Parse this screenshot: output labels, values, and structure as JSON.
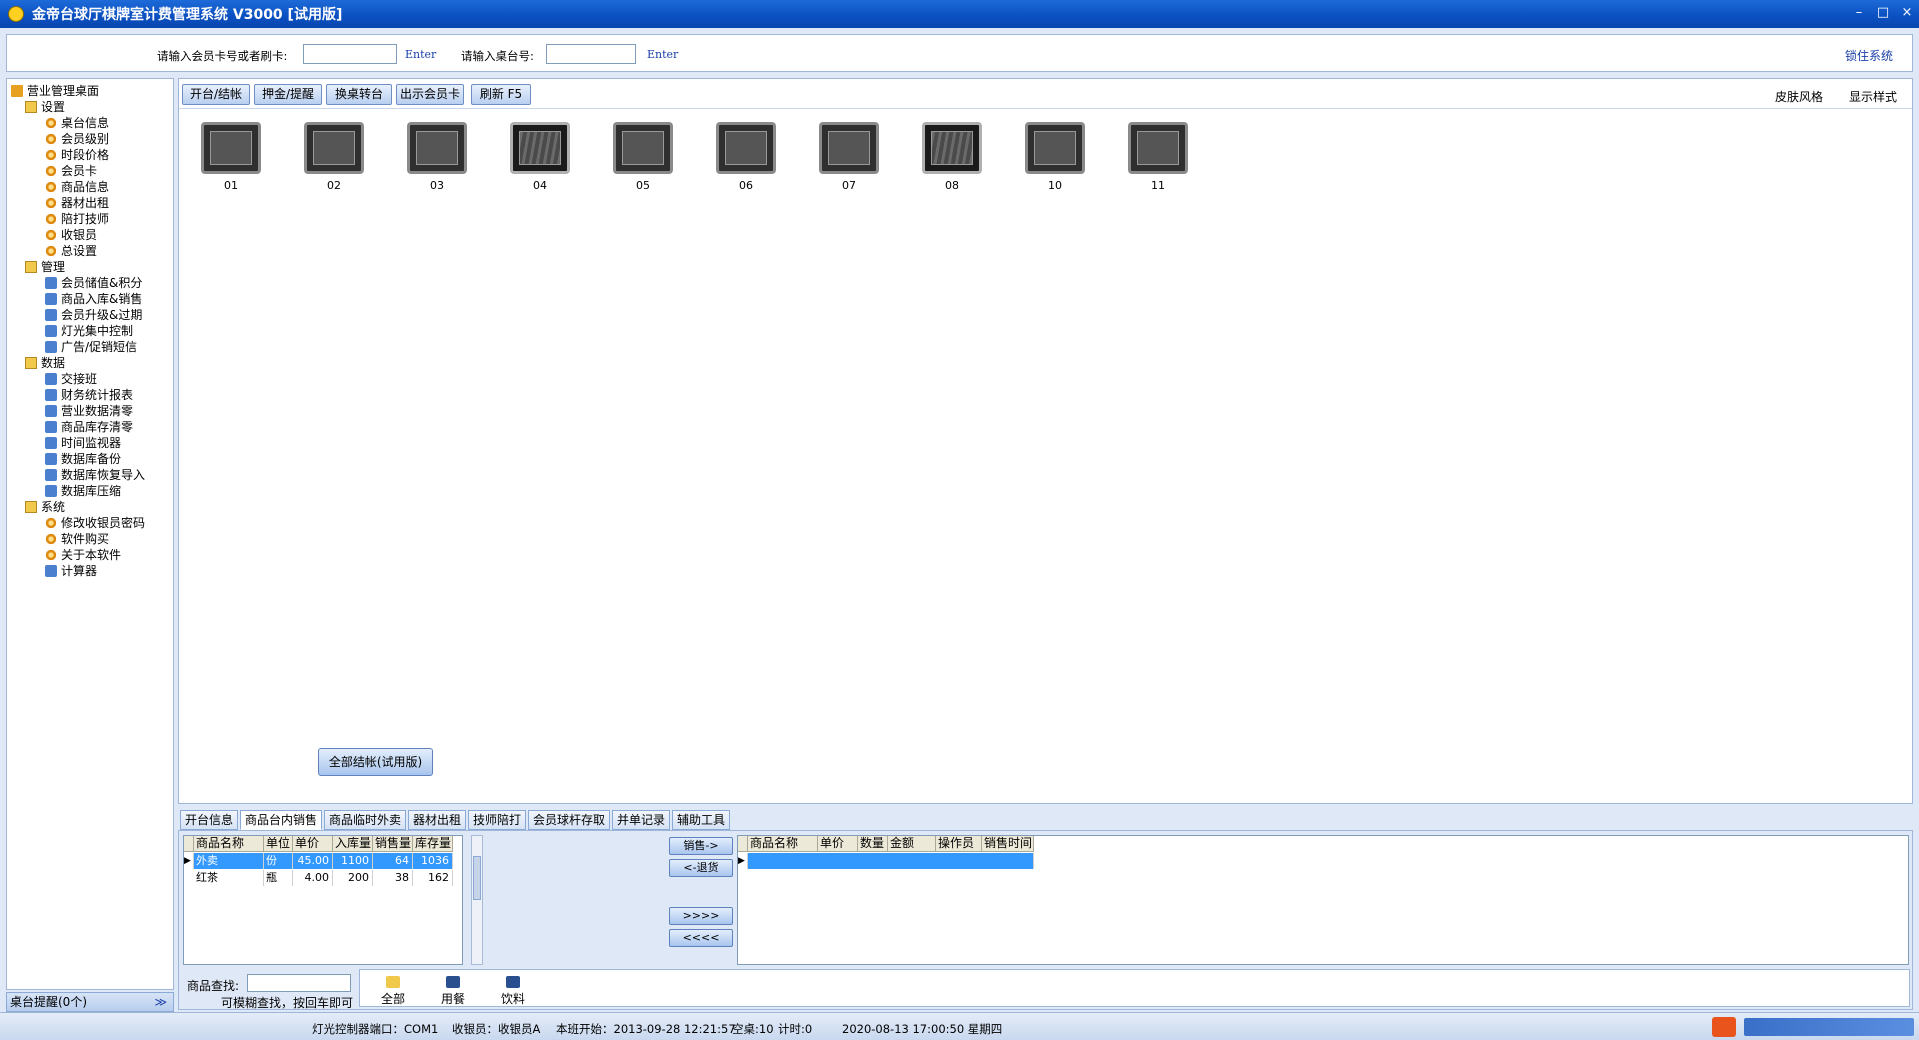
{
  "window": {
    "title": "金帝台球厅棋牌室计费管理系统 V3000 [试用版]",
    "min": "–",
    "max": "□",
    "close": "×"
  },
  "topbar": {
    "member_label": "请输入会员卡号或者刷卡:",
    "member_enter": "Enter",
    "table_label": "请输入桌台号:",
    "table_enter": "Enter",
    "lock": "锁住系统"
  },
  "tree": {
    "root": "营业管理桌面",
    "groups": [
      {
        "label": "设置",
        "items": [
          "桌台信息",
          "会员级别",
          "时段价格",
          "会员卡",
          "商品信息",
          "器材出租",
          "陪打技师",
          "收银员",
          "总设置"
        ]
      },
      {
        "label": "管理",
        "items": [
          "会员储值&积分",
          "商品入库&销售",
          "会员升级&过期",
          "灯光集中控制",
          "广告/促销短信"
        ]
      },
      {
        "label": "数据",
        "items": [
          "交接班",
          "财务统计报表",
          "营业数据清零",
          "商品库存清零",
          "时间监视器",
          "数据库备份",
          "数据库恢复导入",
          "数据库压缩"
        ]
      },
      {
        "label": "系统",
        "items": [
          "修改收银员密码",
          "软件购买",
          "关于本软件",
          "计算器"
        ]
      }
    ]
  },
  "remind": {
    "label": "桌台提醒(0个)",
    "chevron": "≫"
  },
  "toolbar": {
    "buttons": [
      "开台/结帐",
      "押金/提醒",
      "换桌转台",
      "出示会员卡",
      "刷新 F5"
    ],
    "skin": "皮肤风格",
    "display": "显示样式"
  },
  "desks": [
    {
      "label": "01",
      "busy": false
    },
    {
      "label": "02",
      "busy": false
    },
    {
      "label": "03",
      "busy": false
    },
    {
      "label": "04",
      "busy": true
    },
    {
      "label": "05",
      "busy": false
    },
    {
      "label": "06",
      "busy": false
    },
    {
      "label": "07",
      "busy": false
    },
    {
      "label": "08",
      "busy": true
    },
    {
      "label": "10",
      "busy": false
    },
    {
      "label": "11",
      "busy": false
    }
  ],
  "allpay": "全部结帐(试用版)",
  "tabs": [
    "开台信息",
    "商品台内销售",
    "商品临时外卖",
    "器材出租",
    "技师陪打",
    "会员球杆存取",
    "并单记录",
    "辅助工具"
  ],
  "goods": {
    "headers": [
      "商品名称",
      "单位",
      "单价",
      "入库量",
      "销售量",
      "库存量"
    ],
    "rows": [
      [
        "外卖",
        "份",
        "45.00",
        "1100",
        "64",
        "1036"
      ],
      [
        "红茶",
        "瓶",
        "4.00",
        "200",
        "38",
        "162"
      ]
    ]
  },
  "sales": {
    "headers": [
      "商品名称",
      "单价",
      "数量",
      "金额",
      "操作员",
      "销售时间"
    ]
  },
  "move_buttons": [
    "销售->",
    "<-退货",
    ">>>>",
    "<<<<"
  ],
  "search": {
    "label": "商品查找:",
    "hint": "可模糊查找，按回车即可"
  },
  "categories": [
    "全部",
    "用餐",
    "饮料"
  ],
  "status": {
    "light": "灯光控制器端口：COM1",
    "cashier": "收银员：收银员A",
    "shift": "本班开始：2013-09-28 12:21:57",
    "empty": "空桌:10",
    "timing": "计时:0",
    "datetime": "2020-08-13 17:00:50 星期四"
  }
}
